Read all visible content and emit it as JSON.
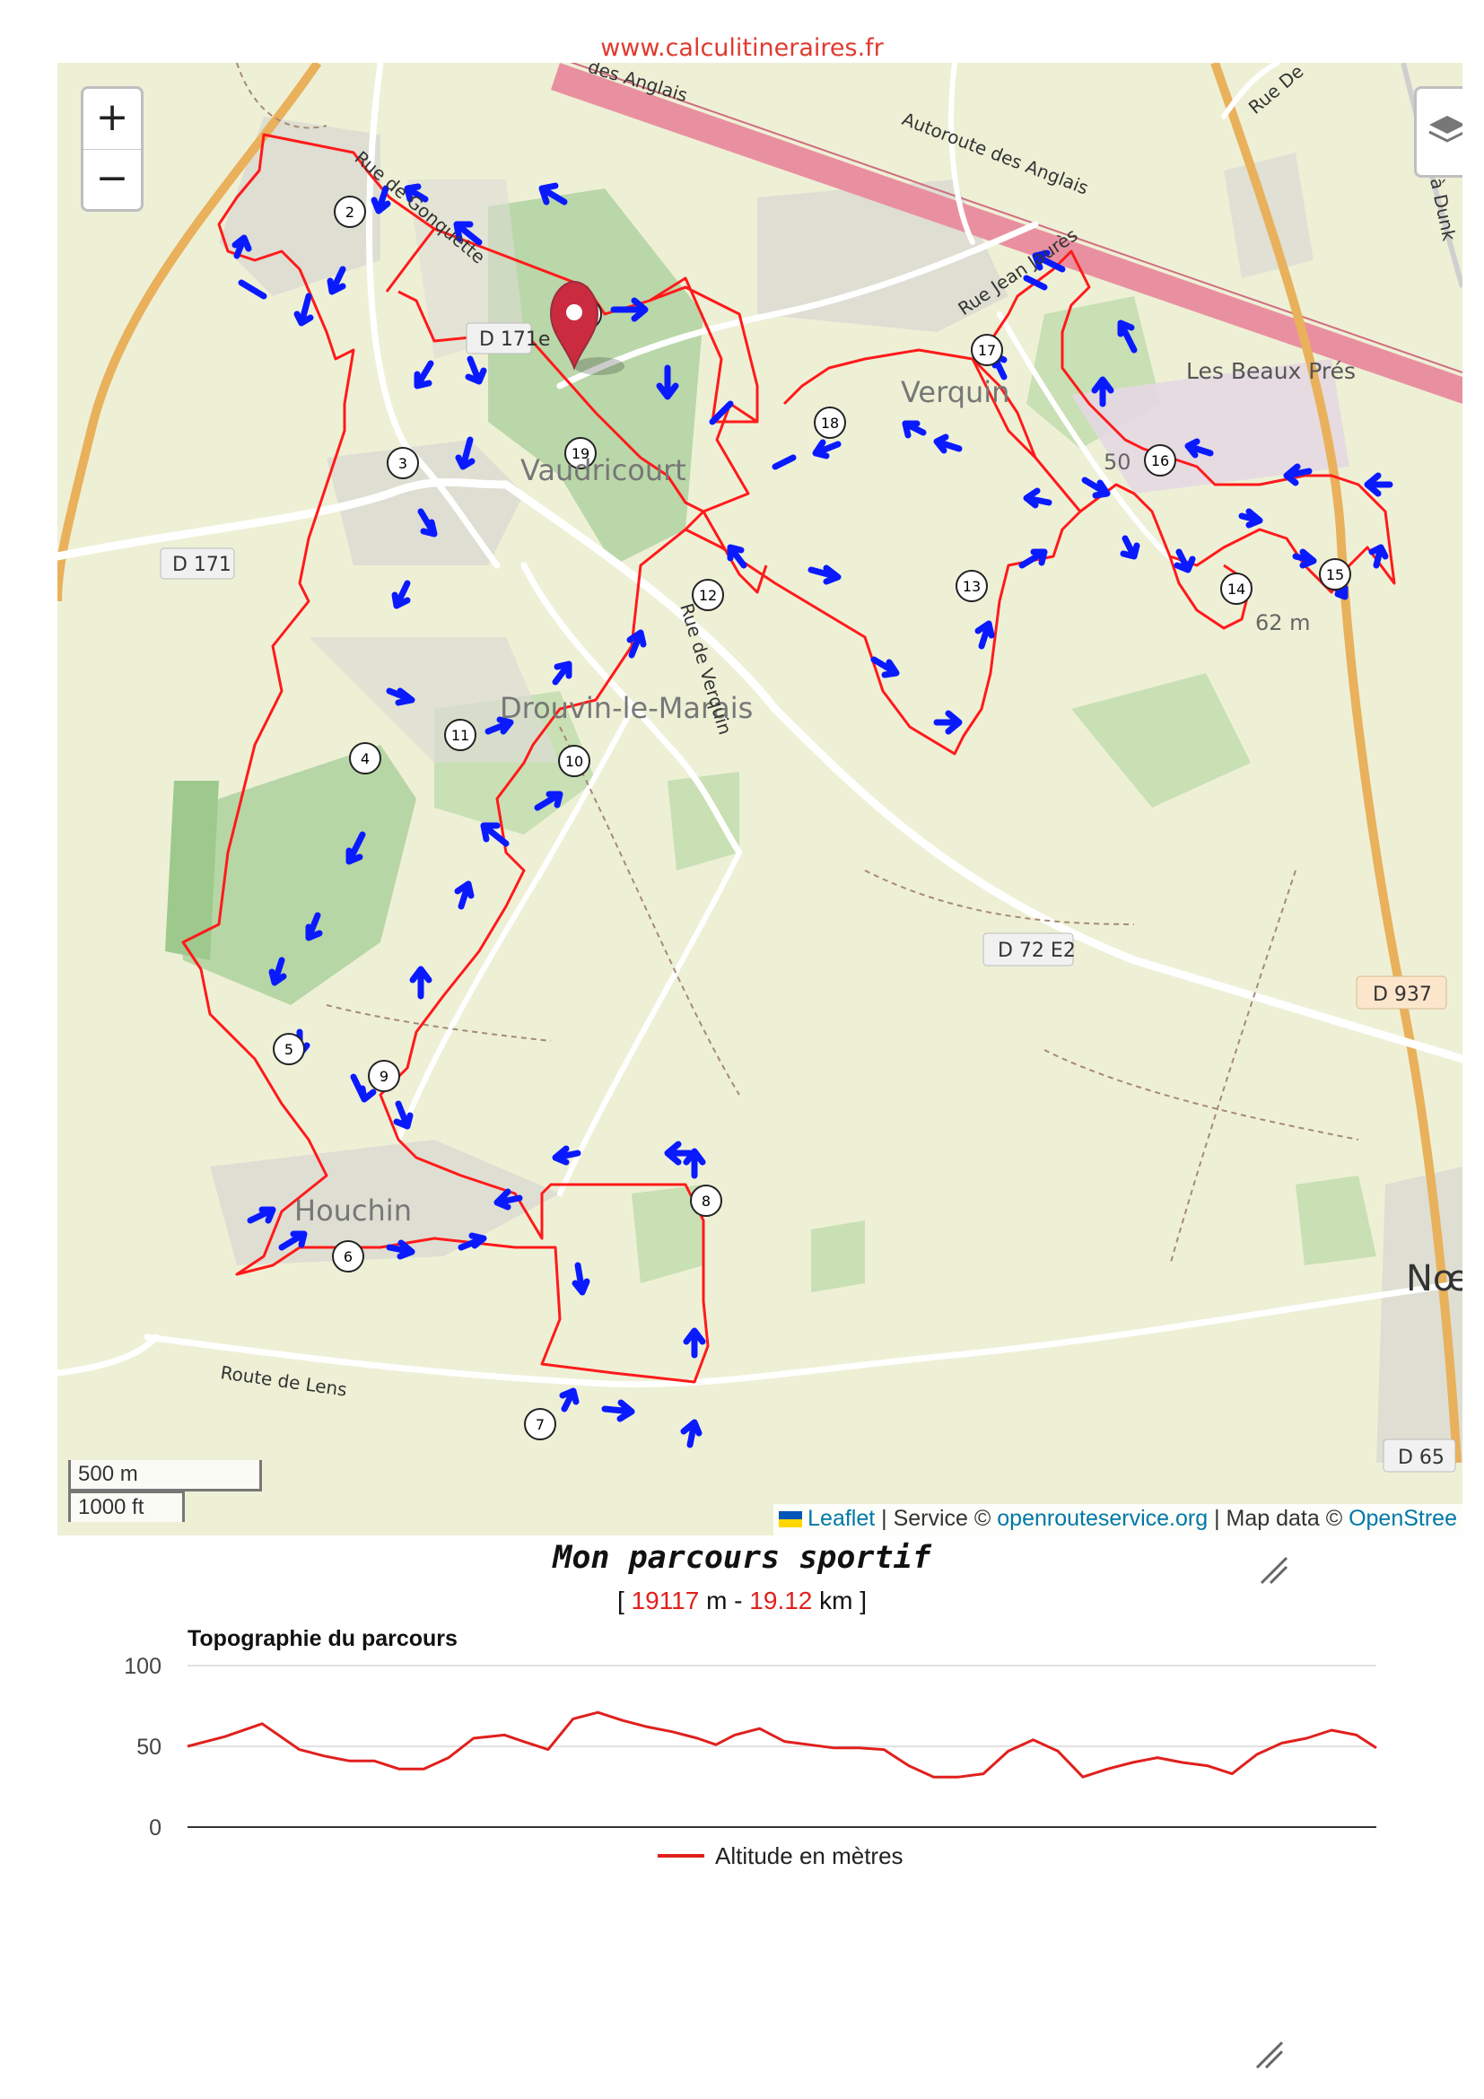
{
  "site": {
    "url": "www.calculitineraires.fr"
  },
  "map": {
    "zoom_in": "+",
    "zoom_out": "−",
    "scale": {
      "metric": "500 m",
      "imperial": "1000 ft"
    },
    "attribution": {
      "leaflet": "Leaflet",
      "service_prefix": " | Service © ",
      "service_link": "openrouteservice.org",
      "data_prefix": " | Map data © ",
      "data_link": "OpenStree"
    },
    "place_labels": {
      "vaudricourt": "Vaudricourt",
      "verquin": "Verquin",
      "drouvin": "Drouvin-le-Marais",
      "houchin": "Houchin",
      "beaux_pres": "Les Beaux Prés",
      "noeux": "Nœ"
    },
    "road_labels": {
      "autoroute": "Autoroute des Anglais",
      "autoroute_top": "des Anglais",
      "rue_jean_jaures": "Rue Jean Jaurès",
      "rue_de_verquin": "Rue de Verquin",
      "rue_de_lens": "Route de Lens",
      "rue_gonquette": "Rue de Gonquette",
      "rue_de_top": "Rue De",
      "dunkerque": "à Dunk",
      "d171": "D 171",
      "d171e": "D 171e",
      "d72e2": "D 72 E2",
      "d937": "D 937",
      "d65": "D 65",
      "elev_62": "62 m",
      "elev_50": "50"
    },
    "waypoints": [
      "1",
      "2",
      "3",
      "4",
      "5",
      "6",
      "7",
      "8",
      "9",
      "10",
      "11",
      "12",
      "13",
      "14",
      "15",
      "16",
      "17",
      "18",
      "19"
    ]
  },
  "chart": {
    "title": "Mon parcours sportif",
    "distance": {
      "open": "[ ",
      "meters": "19117",
      "m_unit": " m - ",
      "km": "19.12",
      "km_unit": " km ]"
    }
  },
  "chart_data": {
    "type": "line",
    "title": "Topographie du parcours",
    "xlabel": "",
    "ylabel": "",
    "ylim": [
      0,
      100
    ],
    "yticks": [
      0,
      50,
      100
    ],
    "grid": true,
    "legend": "bottom",
    "series": [
      {
        "name": "Altitude en mètres",
        "color": "#e0201d",
        "x": [
          0,
          0.6,
          1.2,
          1.8,
          2.2,
          2.6,
          3,
          3.4,
          3.8,
          4.2,
          4.6,
          5.1,
          5.4,
          5.8,
          6.2,
          6.6,
          7,
          7.4,
          7.8,
          8.2,
          8.5,
          8.8,
          9.2,
          9.6,
          10,
          10.4,
          10.8,
          11.2,
          11.6,
          12,
          12.4,
          12.8,
          13.2,
          13.6,
          14,
          14.4,
          14.8,
          15.2,
          15.6,
          16,
          16.4,
          16.8,
          17.2,
          17.6,
          18,
          18.4,
          18.8,
          19.12
        ],
        "values": [
          50,
          56,
          64,
          48,
          44,
          41,
          41,
          36,
          36,
          43,
          55,
          57,
          53,
          48,
          67,
          71,
          66,
          62,
          59,
          55,
          51,
          57,
          61,
          53,
          51,
          49,
          49,
          48,
          38,
          31,
          31,
          33,
          47,
          54,
          47,
          31,
          36,
          40,
          43,
          40,
          38,
          33,
          45,
          52,
          55,
          60,
          57,
          49
        ]
      }
    ]
  }
}
